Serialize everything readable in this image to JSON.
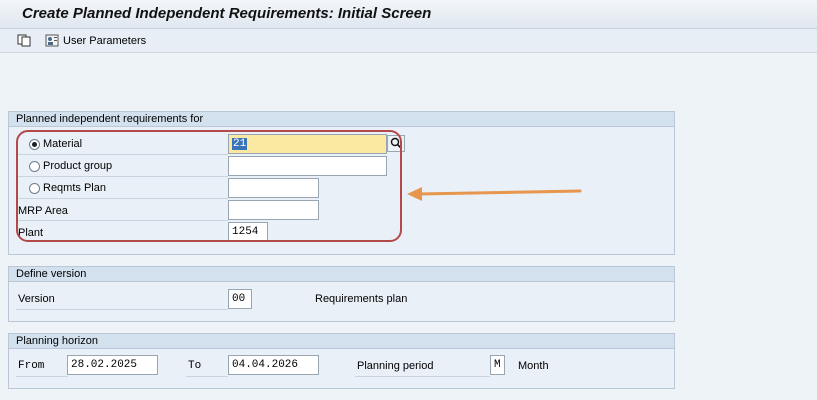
{
  "window": {
    "title": "Create Planned Independent Requirements: Initial Screen"
  },
  "toolbar": {
    "user_params_label": "User Parameters"
  },
  "req_group": {
    "title": "Planned independent requirements for",
    "material_label": "Material",
    "material_value": "21",
    "product_group_label": "Product group",
    "product_group_value": "",
    "reqmts_plan_label": "Reqmts Plan",
    "reqmts_plan_value": "",
    "mrp_area_label": "MRP Area",
    "mrp_area_value": "",
    "plant_label": "Plant",
    "plant_value": "1254",
    "selected_option": "Material"
  },
  "version_group": {
    "title": "Define version",
    "version_label": "Version",
    "version_value": "00",
    "version_text": "Requirements plan"
  },
  "horizon_group": {
    "title": "Planning horizon",
    "from_label": "From",
    "from_value": "28.02.2025",
    "to_label": "To",
    "to_value": "04.04.2026",
    "period_label": "Planning period",
    "period_value": "M",
    "period_text": "Month"
  },
  "colors": {
    "annotation_box": "#b24a4a",
    "annotation_arrow": "#e8964e",
    "required_field": "#fbe9a2"
  }
}
